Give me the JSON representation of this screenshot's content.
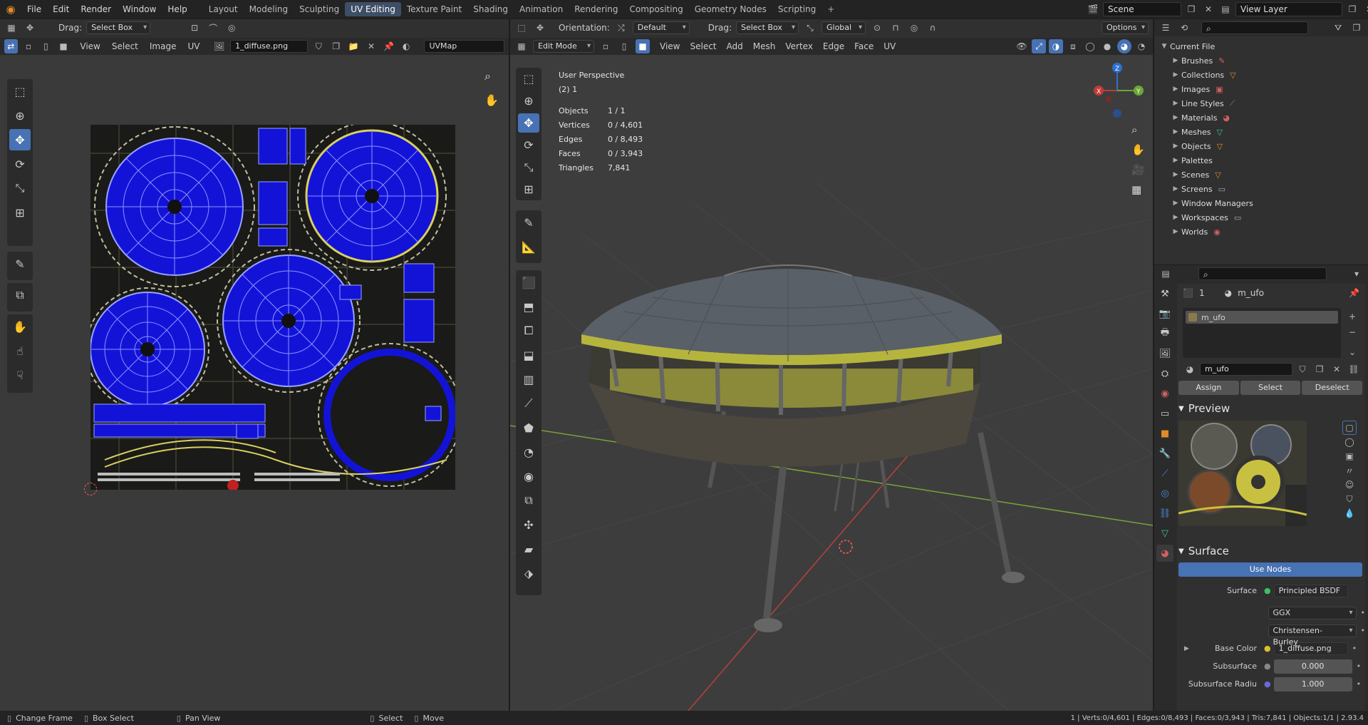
{
  "topbar": {
    "menu": [
      "File",
      "Edit",
      "Render",
      "Window",
      "Help"
    ],
    "workspaces": [
      "Layout",
      "Modeling",
      "Sculpting",
      "UV Editing",
      "Texture Paint",
      "Shading",
      "Animation",
      "Rendering",
      "Compositing",
      "Geometry Nodes",
      "Scripting"
    ],
    "active_workspace": "UV Editing",
    "scene": "Scene",
    "view_layer": "View Layer"
  },
  "uv_editor": {
    "drag_label": "Drag:",
    "drag_value": "Select Box",
    "menus": [
      "View",
      "Select",
      "Image",
      "UV"
    ],
    "image_name": "1_diffuse.png",
    "uv_map": "UVMap"
  },
  "viewport": {
    "orientation_label": "Orientation:",
    "orientation_value": "Default",
    "drag_label": "Drag:",
    "drag_value": "Select Box",
    "transform": "Global",
    "options": "Options",
    "mode": "Edit Mode",
    "menus": [
      "View",
      "Select",
      "Add",
      "Mesh",
      "Vertex",
      "Edge",
      "Face",
      "UV"
    ],
    "view_name": "User Perspective",
    "collection": "(2) 1",
    "stats": [
      {
        "k": "Objects",
        "v": "1 / 1"
      },
      {
        "k": "Vertices",
        "v": "0 / 4,601"
      },
      {
        "k": "Edges",
        "v": "0 / 8,493"
      },
      {
        "k": "Faces",
        "v": "0 / 3,943"
      },
      {
        "k": "Triangles",
        "v": "7,841"
      }
    ],
    "axes": {
      "x": "X",
      "y": "Y",
      "z": "Z"
    }
  },
  "outliner": {
    "root": "Current File",
    "items": [
      "Brushes",
      "Collections",
      "Images",
      "Line Styles",
      "Materials",
      "Meshes",
      "Objects",
      "Palettes",
      "Scenes",
      "Screens",
      "Window Managers",
      "Workspaces",
      "Worlds"
    ]
  },
  "properties": {
    "object_num": "1",
    "material_name": "m_ufo",
    "slot_name": "m_ufo",
    "material_field": "m_ufo",
    "assign": "Assign",
    "select": "Select",
    "deselect": "Deselect",
    "preview_title": "Preview",
    "surface_title": "Surface",
    "use_nodes": "Use Nodes",
    "rows": [
      {
        "k": "Surface",
        "v": "Principled BSDF"
      },
      {
        "k": "",
        "v": "GGX"
      },
      {
        "k": "",
        "v": "Christensen-Burley"
      },
      {
        "k": "Base Color",
        "v": "1_diffuse.png"
      },
      {
        "k": "Subsurface",
        "v": "0.000"
      },
      {
        "k": "Subsurface Radiu",
        "v": "1.000"
      }
    ]
  },
  "statusbar": {
    "items": [
      "Change Frame",
      "Box Select",
      "Pan View",
      "Select",
      "Move"
    ],
    "info": "1 | Verts:0/4,601 | Edges:0/8,493 | Faces:0/3,943 | Tris:7,841 | Objects:1/1 | 2.93.4"
  },
  "colors": {
    "accent": "#4772b3",
    "uv_face": "#1414e0",
    "grid": "#3d3d3d"
  }
}
